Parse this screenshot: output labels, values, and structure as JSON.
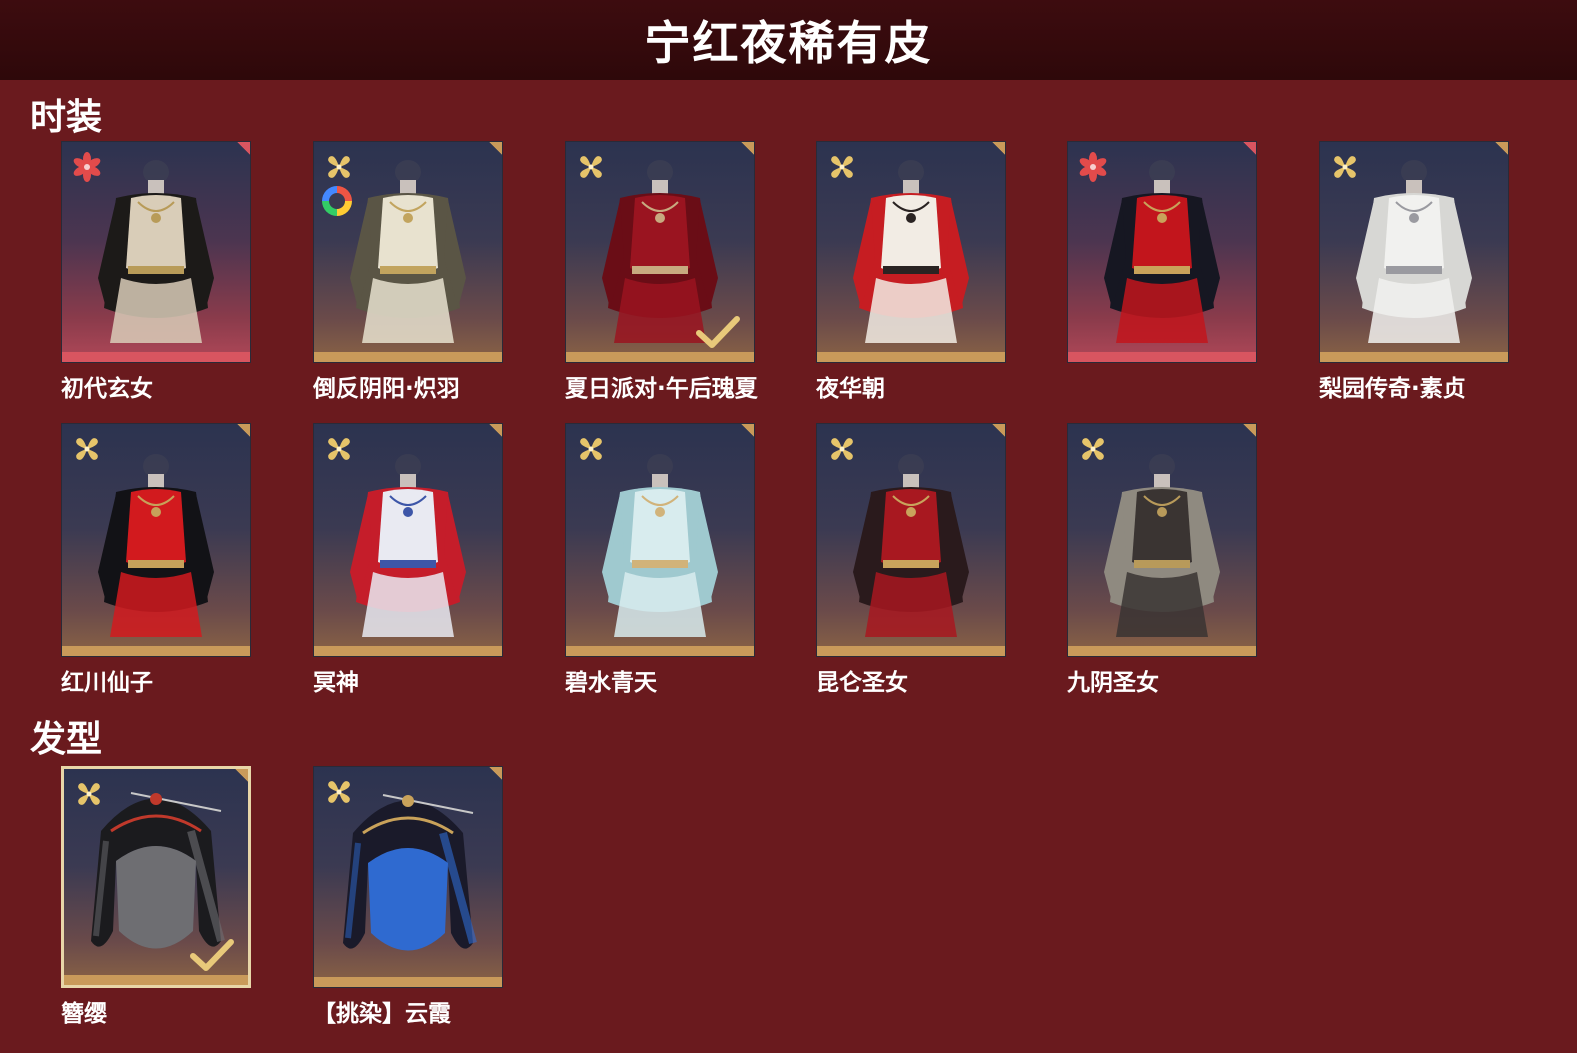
{
  "header": {
    "title": "宁红夜稀有皮"
  },
  "sections": {
    "outfits": {
      "title": "时装"
    },
    "hairstyles": {
      "title": "发型"
    }
  },
  "outfits": [
    {
      "name": "初代玄女",
      "rarity": "red",
      "owned": false,
      "dye": false,
      "palette": [
        "#d9cdb8",
        "#1c1a18",
        "#b89b58"
      ]
    },
    {
      "name": "倒反阴阳·炽羽",
      "rarity": "gold",
      "owned": false,
      "dye": true,
      "palette": [
        "#e8e2cf",
        "#5a5545",
        "#c2a45e"
      ]
    },
    {
      "name": "夏日派对·午后瑰夏",
      "rarity": "gold",
      "owned": true,
      "dye": false,
      "palette": [
        "#9a1420",
        "#6a0d16",
        "#c8aa80"
      ]
    },
    {
      "name": "夜华朝",
      "rarity": "gold",
      "owned": false,
      "dye": false,
      "palette": [
        "#f2ece4",
        "#c61d22",
        "#2a2322"
      ]
    },
    {
      "name": "",
      "rarity": "red",
      "owned": false,
      "dye": false,
      "palette": [
        "#c2151c",
        "#161722",
        "#c9a25a"
      ]
    },
    {
      "name": "梨园传奇·素贞",
      "rarity": "gold",
      "owned": false,
      "dye": false,
      "palette": [
        "#f1f1ef",
        "#d7d7d4",
        "#9a9aa0"
      ]
    },
    {
      "name": "红川仙子",
      "rarity": "gold",
      "owned": false,
      "dye": false,
      "palette": [
        "#d21a1e",
        "#121216",
        "#c7a15a"
      ]
    },
    {
      "name": "冥神",
      "rarity": "gold",
      "owned": false,
      "dye": false,
      "palette": [
        "#e9eaf2",
        "#c51d2a",
        "#3d56a8"
      ]
    },
    {
      "name": "碧水青天",
      "rarity": "gold",
      "owned": false,
      "dye": false,
      "palette": [
        "#d8ecee",
        "#9fc9cf",
        "#d1b37a"
      ]
    },
    {
      "name": "昆仑圣女",
      "rarity": "gold",
      "owned": false,
      "dye": false,
      "palette": [
        "#a81820",
        "#2a1a1c",
        "#c9a35c"
      ]
    },
    {
      "name": "九阴圣女",
      "rarity": "gold",
      "owned": false,
      "dye": false,
      "palette": [
        "#3a3432",
        "#8f8a80",
        "#b89a5a"
      ]
    }
  ],
  "hairstyles": [
    {
      "name": "簪缨",
      "rarity": "gold",
      "owned": true,
      "palette": [
        "#1b1b1e",
        "#6e6e72",
        "#c0392b"
      ]
    },
    {
      "name": "【挑染】云霞",
      "rarity": "gold",
      "owned": false,
      "palette": [
        "#1a1a2a",
        "#2f6ad0",
        "#c9a25a"
      ]
    }
  ],
  "colors": {
    "background": "#6a1a1e",
    "header": "#3d0c0f",
    "gold_bar": "#c99a5a",
    "red_bar": "#d85560",
    "badge_gold": "#e6c46a",
    "badge_red": "#e24b4b",
    "check": "#e8c97a"
  },
  "icons": {
    "gold_badge": "four-petal-flower-icon",
    "red_badge": "six-petal-flower-icon",
    "owned": "checkmark-icon",
    "dye": "color-wheel-icon"
  }
}
